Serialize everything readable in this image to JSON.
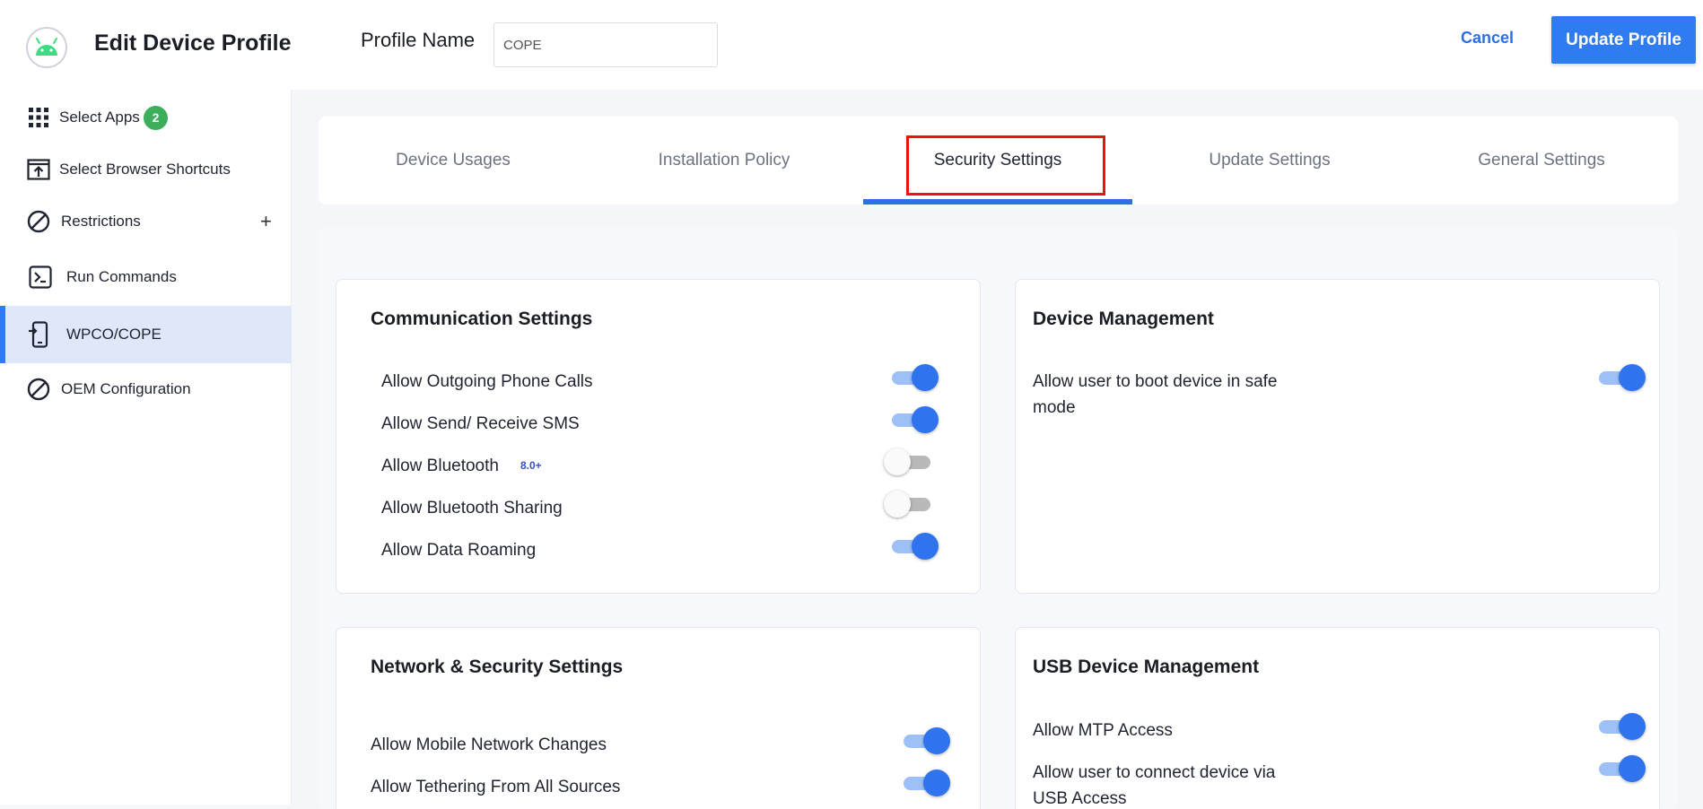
{
  "header": {
    "title": "Edit Device Profile",
    "profile_name_label": "Profile Name",
    "profile_name_value": "COPE",
    "cancel_label": "Cancel",
    "update_label": "Update Profile"
  },
  "sidebar": {
    "items": [
      {
        "label": "Select Apps",
        "icon": "apps-grid-icon",
        "badge": "2"
      },
      {
        "label": "Select Browser Shortcuts",
        "icon": "browser-shortcut-icon"
      },
      {
        "label": "Restrictions",
        "icon": "restriction-icon",
        "expand": "+"
      },
      {
        "label": "Run Commands",
        "icon": "terminal-icon"
      },
      {
        "label": "WPCO/COPE",
        "icon": "device-icon",
        "active": true
      },
      {
        "label": "OEM Configuration",
        "icon": "restriction-icon"
      }
    ]
  },
  "tabs": [
    {
      "label": "Device Usages"
    },
    {
      "label": "Installation Policy"
    },
    {
      "label": "Security Settings",
      "active": true
    },
    {
      "label": "Update Settings"
    },
    {
      "label": "General Settings"
    }
  ],
  "cards": {
    "communication": {
      "title": "Communication Settings",
      "rows": [
        {
          "label": "Allow Outgoing Phone Calls",
          "on": true
        },
        {
          "label": "Allow Send/ Receive SMS",
          "on": true
        },
        {
          "label": "Allow Bluetooth",
          "badge": "8.0+",
          "on": false
        },
        {
          "label": "Allow Bluetooth Sharing",
          "on": false
        },
        {
          "label": "Allow Data Roaming",
          "on": true
        }
      ]
    },
    "device_management": {
      "title": "Device Management",
      "rows": [
        {
          "label_line1": "Allow user to boot device in safe",
          "label_line2": "mode",
          "on": true
        }
      ]
    },
    "network": {
      "title": "Network & Security Settings",
      "rows": [
        {
          "label": "Allow Mobile Network Changes",
          "on": true
        },
        {
          "label": "Allow Tethering From All Sources",
          "on": true
        }
      ]
    },
    "usb": {
      "title": "USB Device Management",
      "rows": [
        {
          "label": "Allow MTP Access",
          "on": true
        },
        {
          "label_line1": "Allow user to connect device via",
          "label_line2": "USB Access",
          "on": true
        }
      ]
    }
  },
  "colors": {
    "accent": "#2f7bf0",
    "active_tab_underline": "#2f6fe4",
    "highlight_box": "#ee1111",
    "badge_green": "#3cae5c",
    "toggle_on": "#2f73ee"
  }
}
